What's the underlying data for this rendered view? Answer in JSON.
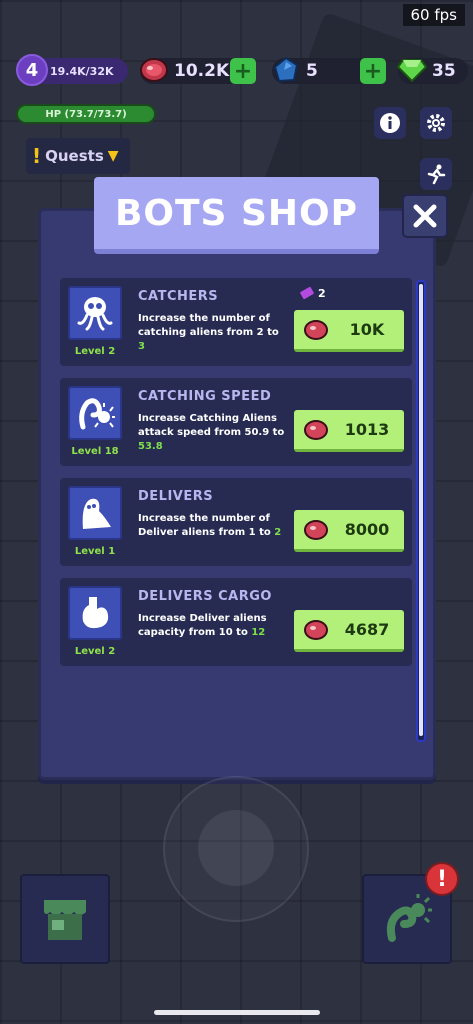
{
  "status": {
    "fps": "60 fps"
  },
  "hud": {
    "level": "4",
    "xp": "19.4K/32K",
    "meat": "10.2K",
    "gems": "5",
    "emeralds": "35",
    "hp": "HP (73.7/73.7)"
  },
  "quests": {
    "label": "Quests"
  },
  "shop": {
    "title": "BOTS SHOP",
    "items": [
      {
        "name": "CATCHERS",
        "desc_a": "Increase the number of catching aliens from 2 to ",
        "desc_b": "3",
        "level": "Level 2",
        "price": "10K",
        "tag": "2",
        "icon": "skull-tentacle-icon"
      },
      {
        "name": "CATCHING SPEED",
        "desc_a": "Increase Catching Aliens attack speed from 50.9 to ",
        "desc_b": "53.8",
        "level": "Level 18",
        "price": "1013",
        "icon": "spiked-tentacle-icon"
      },
      {
        "name": "DELIVERS",
        "desc_a": "Increase the number of Deliver aliens from 1 to ",
        "desc_b": "2",
        "level": "Level 1",
        "price": "8000",
        "icon": "ghost-alien-icon"
      },
      {
        "name": "DELIVERS CARGO",
        "desc_a": "Increase Deliver aliens capacity from 10 to ",
        "desc_b": "12",
        "level": "Level 2",
        "price": "4687",
        "icon": "stomach-icon"
      }
    ]
  },
  "badge": "!",
  "colors": {
    "buy": "#b2f07a",
    "panel": "#363a70",
    "title": "#a6a7f2",
    "highlight": "#7ee04a"
  }
}
